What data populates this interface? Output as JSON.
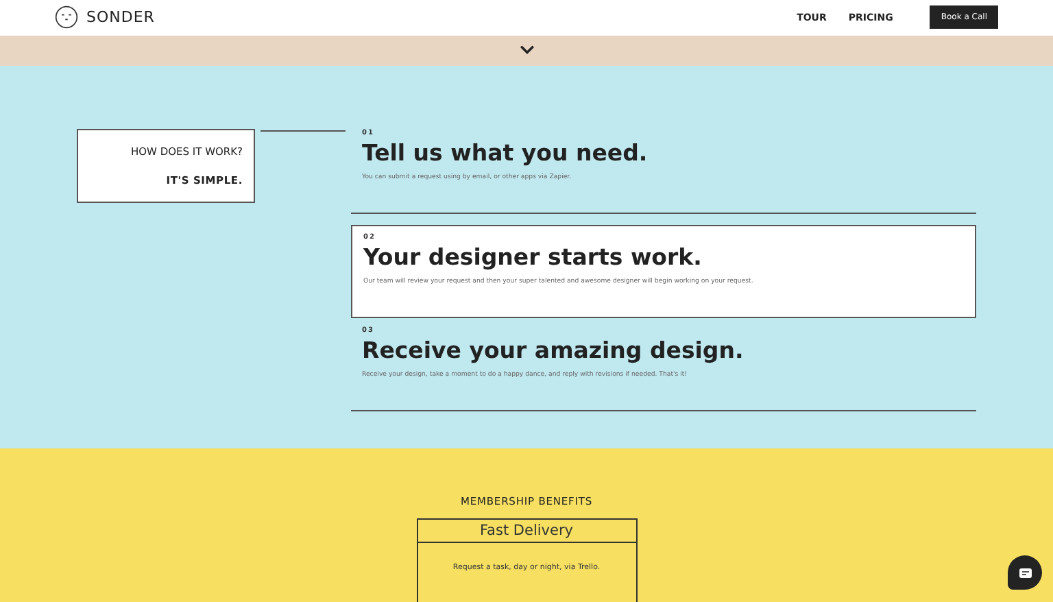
{
  "header": {
    "brand": "SONDER",
    "nav": [
      "TOUR",
      "PRICING"
    ],
    "cta": "Book a Call"
  },
  "intro": {
    "question": "HOW DOES IT WORK?",
    "answer": "IT'S SIMPLE."
  },
  "steps": [
    {
      "number": "01",
      "title": "Tell us what you need.",
      "text": "You can submit a request using by email, or other apps via Zapier.",
      "selected": false
    },
    {
      "number": "02",
      "title": "Your designer starts work.",
      "text": "Our team will review your request and then your super talented and awesome designer will begin working on your request.",
      "selected": true
    },
    {
      "number": "03",
      "title": "Receive your amazing design.",
      "text": "Receive your design, take a moment to do a happy dance, and reply with revisions if needed. That's it!",
      "selected": false
    }
  ],
  "benefits": {
    "title": "MEMBERSHIP BENEFITS",
    "card_title": "Fast Delivery",
    "card_text": "Request a task, day or night, via Trello."
  }
}
